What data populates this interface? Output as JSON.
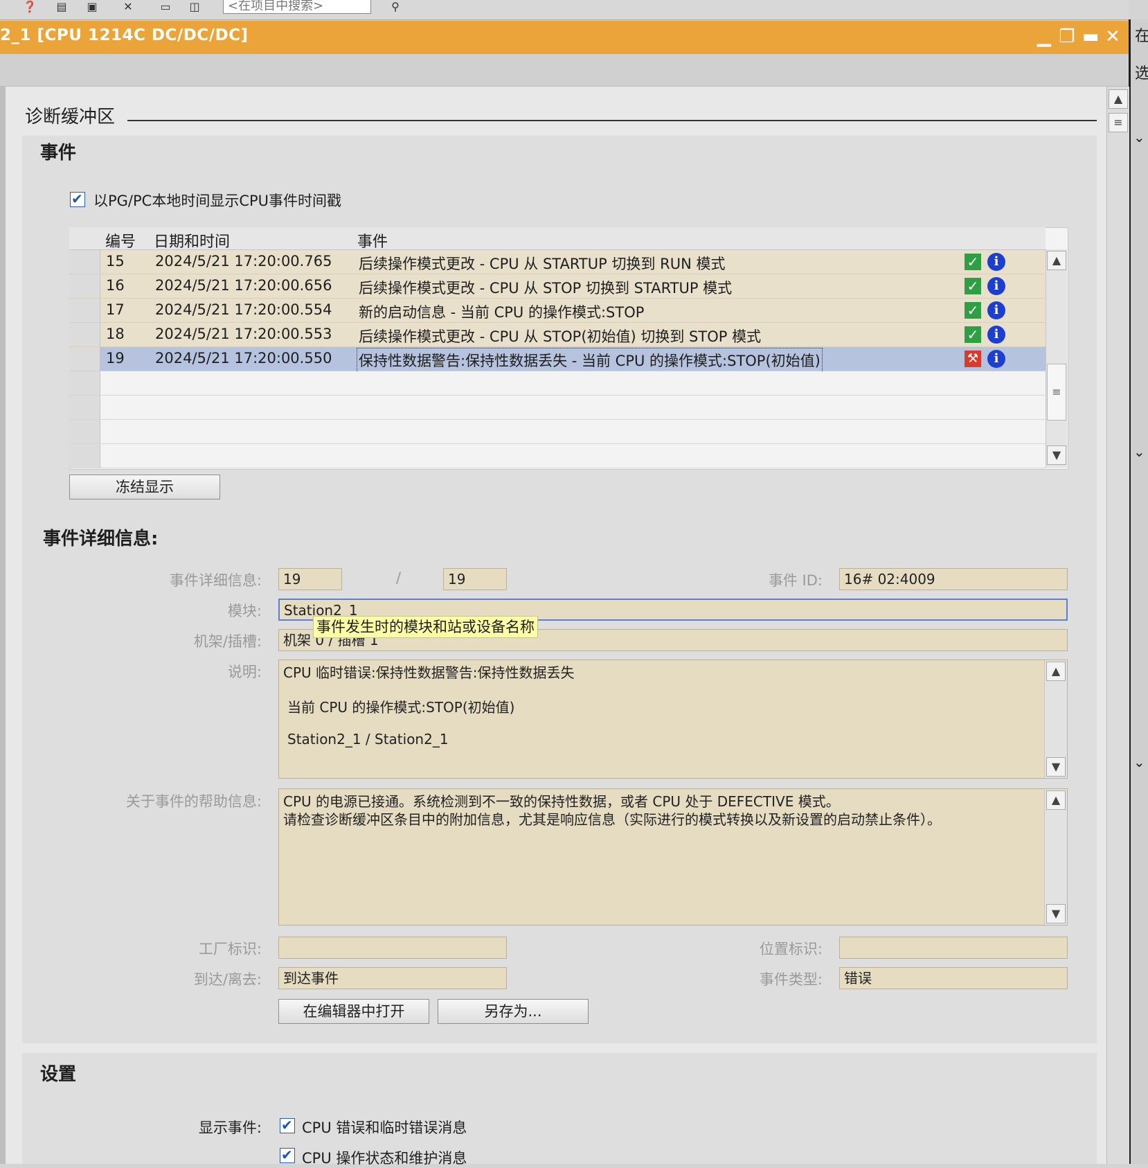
{
  "toolbar": {
    "search_placeholder": "<在项目中搜索>"
  },
  "window": {
    "title": "2_1 [CPU 1214C DC/DC/DC]",
    "right_panel_chars": [
      "在",
      "选"
    ]
  },
  "section": {
    "title": "诊断缓冲区"
  },
  "events": {
    "heading": "事件",
    "local_time_checkbox_label": "以PG/PC本地时间显示CPU事件时间戳",
    "columns": [
      "编号",
      "日期和时间",
      "事件"
    ],
    "rows": [
      {
        "no": "15",
        "datetime": "2024/5/21 17:20:00.765",
        "event": "后续操作模式更改 - CPU 从 STARTUP 切换到 RUN 模式",
        "status": "ok"
      },
      {
        "no": "16",
        "datetime": "2024/5/21 17:20:00.656",
        "event": "后续操作模式更改 - CPU 从 STOP 切换到 STARTUP 模式",
        "status": "ok"
      },
      {
        "no": "17",
        "datetime": "2024/5/21 17:20:00.554",
        "event": "新的启动信息 - 当前 CPU 的操作模式:STOP",
        "status": "ok"
      },
      {
        "no": "18",
        "datetime": "2024/5/21 17:20:00.553",
        "event": "后续操作模式更改 - CPU 从 STOP(初始值) 切换到 STOP 模式",
        "status": "ok"
      },
      {
        "no": "19",
        "datetime": "2024/5/21 17:20:00.550",
        "event": "保持性数据警告:保持性数据丢失 - 当前 CPU 的操作模式:STOP(初始值)",
        "status": "error",
        "selected": true
      }
    ],
    "freeze_button": "冻结显示"
  },
  "details": {
    "heading": "事件详细信息:",
    "labels": {
      "detail": "事件详细信息:",
      "module": "模块:",
      "rack_slot": "机架/插槽:",
      "description": "说明:",
      "help": "关于事件的帮助信息:",
      "plant_id": "工厂标识:",
      "location_id": "位置标识:",
      "arrive_leave": "到达/离去:",
      "event_type": "事件类型:",
      "event_id": "事件 ID:"
    },
    "detail_index": "19",
    "separator": "/",
    "detail_total": "19",
    "event_id": "16# 02:4009",
    "module": "Station2_1",
    "rack_slot": "机架 0 / 插槽 1",
    "tooltip": "事件发生时的模块和站或设备名称",
    "description_lines": [
      "CPU 临时错误:保持性数据警告:保持性数据丢失",
      "当前 CPU 的操作模式:STOP(初始值)",
      "Station2_1 / Station2_1"
    ],
    "help_lines": [
      "CPU 的电源已接通。系统检测到不一致的保持性数据，或者 CPU 处于 DEFECTIVE 模式。",
      "请检查诊断缓冲区条目中的附加信息，尤其是响应信息（实际进行的模式转换以及新设置的启动禁止条件）。"
    ],
    "plant_id": "",
    "location_id": "",
    "arrive_leave": "到达事件",
    "event_type": "错误",
    "open_in_editor_button": "在编辑器中打开",
    "save_as_button": "另存为..."
  },
  "settings": {
    "heading": "设置",
    "show_events_label": "显示事件:",
    "options": [
      "CPU 错误和临时错误消息",
      "CPU 操作状态和维护消息"
    ]
  },
  "colors": {
    "title_bar": "#eba43a",
    "row_bg": "#e9e0cc",
    "selected_row": "#b6c3de",
    "field_bg": "#e6dcc2",
    "ok_icon": "#2ea043",
    "error_icon": "#d93a2b",
    "info_icon": "#1d3fd1"
  }
}
